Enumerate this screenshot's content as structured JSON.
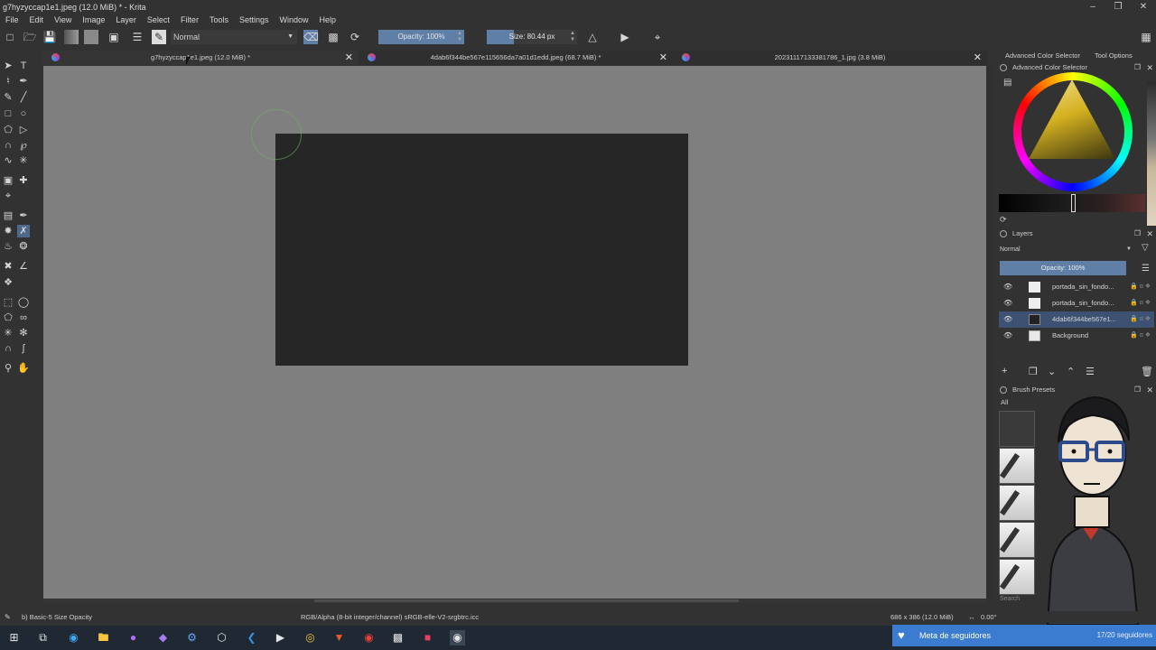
{
  "window": {
    "title": "g7hyzyccap1e1.jpeg (12.0 MiB) * - Krita",
    "controls": [
      "minimize-icon",
      "restore-icon",
      "close-icon"
    ]
  },
  "menu": [
    "File",
    "Edit",
    "View",
    "Image",
    "Layer",
    "Select",
    "Filter",
    "Tools",
    "Settings",
    "Window",
    "Help"
  ],
  "toolbar": {
    "blend_mode": "Normal",
    "opacity": "Opacity: 100%",
    "opacity_value": 100,
    "size": "Size: 80.44 px",
    "size_fill_fraction": 0.3
  },
  "tabs": [
    {
      "name": "g7hyzyccap1e1.jpeg (12.0 MiB) *"
    },
    {
      "name": "4dab6f344be567e115656da7a01d1edd.jpeg (68.7 MiB) *"
    },
    {
      "name": "20231117133381786_1.jpg (3.8 MiB)"
    }
  ],
  "dockers": {
    "top_tabs": [
      "Advanced Color Selector",
      "Tool Options"
    ],
    "color_selector_title": "Advanced Color Selector",
    "layers_title": "Layers",
    "layer_blend": "Normal",
    "layer_opacity": "Opacity: 100%",
    "layers": [
      {
        "name": "portada_sin_fondo...",
        "selected": false
      },
      {
        "name": "portada_sin_fondo...",
        "selected": false
      },
      {
        "name": "4dab6f344be567e1...",
        "selected": true
      },
      {
        "name": "Background",
        "selected": false
      }
    ],
    "brush_presets_title": "Brush Presets",
    "brush_filter": "All",
    "search_label": "Search"
  },
  "status": {
    "brush": "b) Basic-5 Size Opacity",
    "color_model": "RGB/Alpha (8-bit integer/channel)  sRGB-elle-V2-srgbtrc.icc",
    "image_size": "686 x 386 (12.0 MiB)",
    "rotation": "0.00°"
  },
  "overlay": {
    "follow_text": "Meta de seguidores",
    "follow_count": "17/20 seguidores"
  },
  "colors": {
    "accent": "#5f7fa6",
    "canvas_bg": "#7f7f7f",
    "document": "#262627",
    "follow_bar": "#3b7bd0"
  }
}
